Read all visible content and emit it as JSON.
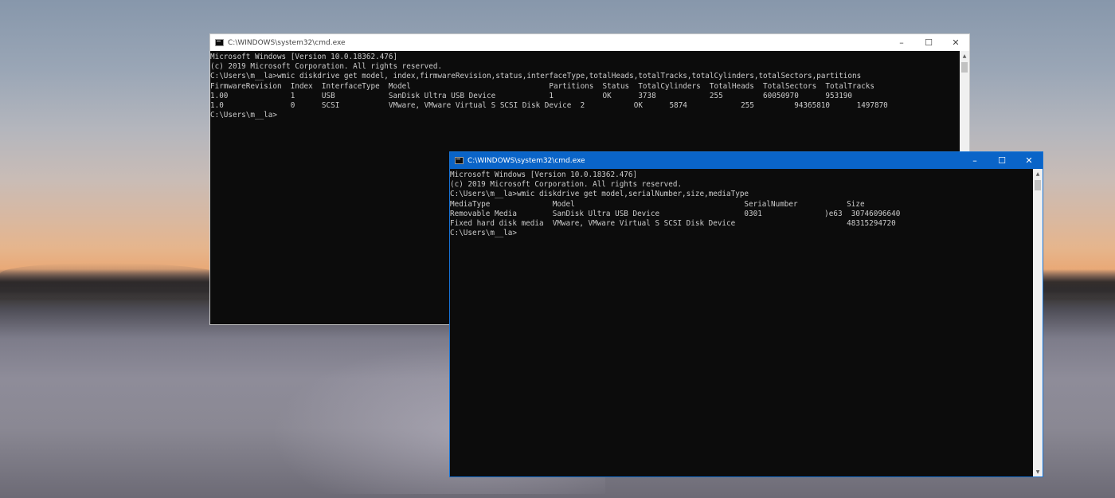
{
  "window_back": {
    "title": "C:\\WINDOWS\\system32\\cmd.exe",
    "controls": {
      "minimize": "–",
      "maximize": "☐",
      "close": "✕"
    },
    "lines": [
      "Microsoft Windows [Version 10.0.18362.476]",
      "(c) 2019 Microsoft Corporation. All rights reserved.",
      "",
      "C:\\Users\\m__la>wmic diskdrive get model, index,firmwareRevision,status,interfaceType,totalHeads,totalTracks,totalCylinders,totalSectors,partitions",
      "FirmwareRevision  Index  InterfaceType  Model                               Partitions  Status  TotalCylinders  TotalHeads  TotalSectors  TotalTracks",
      "1.00              1      USB            SanDisk Ultra USB Device            1           OK      3738            255         60050970      953190",
      "1.0               0      SCSI           VMware, VMware Virtual S SCSI Disk Device  2           OK      5874            255         94365810      1497870",
      "",
      "",
      "C:\\Users\\m__la>"
    ]
  },
  "window_front": {
    "title": "C:\\WINDOWS\\system32\\cmd.exe",
    "controls": {
      "minimize": "–",
      "maximize": "☐",
      "close": "✕"
    },
    "lines": [
      "Microsoft Windows [Version 10.0.18362.476]",
      "(c) 2019 Microsoft Corporation. All rights reserved.",
      "",
      "C:\\Users\\m__la>wmic diskdrive get model,serialNumber,size,mediaType",
      "MediaType              Model                                      SerialNumber           Size",
      "Removable Media        SanDisk Ultra USB Device                   0301              )e63  30746096640",
      "Fixed hard disk media  VMware, VMware Virtual S SCSI Disk Device                         48315294720",
      "",
      "",
      "C:\\Users\\m__la>"
    ]
  },
  "scrollbar": {
    "up": "▲",
    "down": "▼"
  },
  "colors": {
    "console_bg": "#0c0c0c",
    "console_text": "#cccccc",
    "active_titlebar": "#0a64c8",
    "inactive_titlebar": "#ffffff"
  }
}
